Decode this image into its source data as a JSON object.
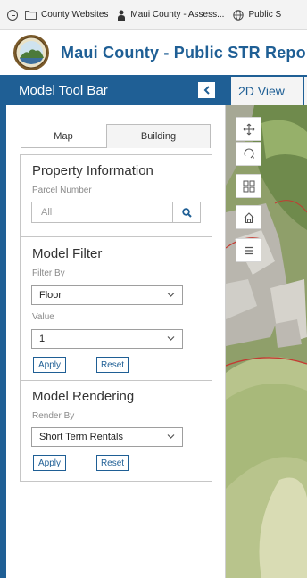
{
  "browser": {
    "bookmarks": [
      {
        "label": "County Websites",
        "icon": "folder-icon"
      },
      {
        "label": "Maui County - Assess...",
        "icon": "person-icon"
      },
      {
        "label": "Public S",
        "icon": "globe-icon"
      }
    ]
  },
  "header": {
    "title": "Maui County - Public STR Report"
  },
  "toolbar": {
    "title": "Model Tool Bar",
    "collapse_icon": "chevron-left-icon",
    "tabs": [
      {
        "label": "Map",
        "active": false
      },
      {
        "label": "Building",
        "active": true
      }
    ],
    "property_info": {
      "title": "Property Information",
      "parcel_label": "Parcel Number",
      "parcel_placeholder": "All",
      "search_icon": "search-icon"
    },
    "model_filter": {
      "title": "Model Filter",
      "filter_by_label": "Filter By",
      "filter_by_value": "Floor",
      "value_label": "Value",
      "value_value": "1",
      "apply_label": "Apply",
      "reset_label": "Reset"
    },
    "model_rendering": {
      "title": "Model Rendering",
      "render_by_label": "Render By",
      "render_by_value": "Short Term Rentals",
      "apply_label": "Apply",
      "reset_label": "Reset"
    }
  },
  "map_view": {
    "tab_label": "2D View",
    "tools": [
      "pan-icon",
      "rotate-icon",
      "grid-icon",
      "home-icon",
      "list-icon"
    ]
  },
  "colors": {
    "brand": "#1f5f95",
    "border": "#c6c6c6"
  }
}
